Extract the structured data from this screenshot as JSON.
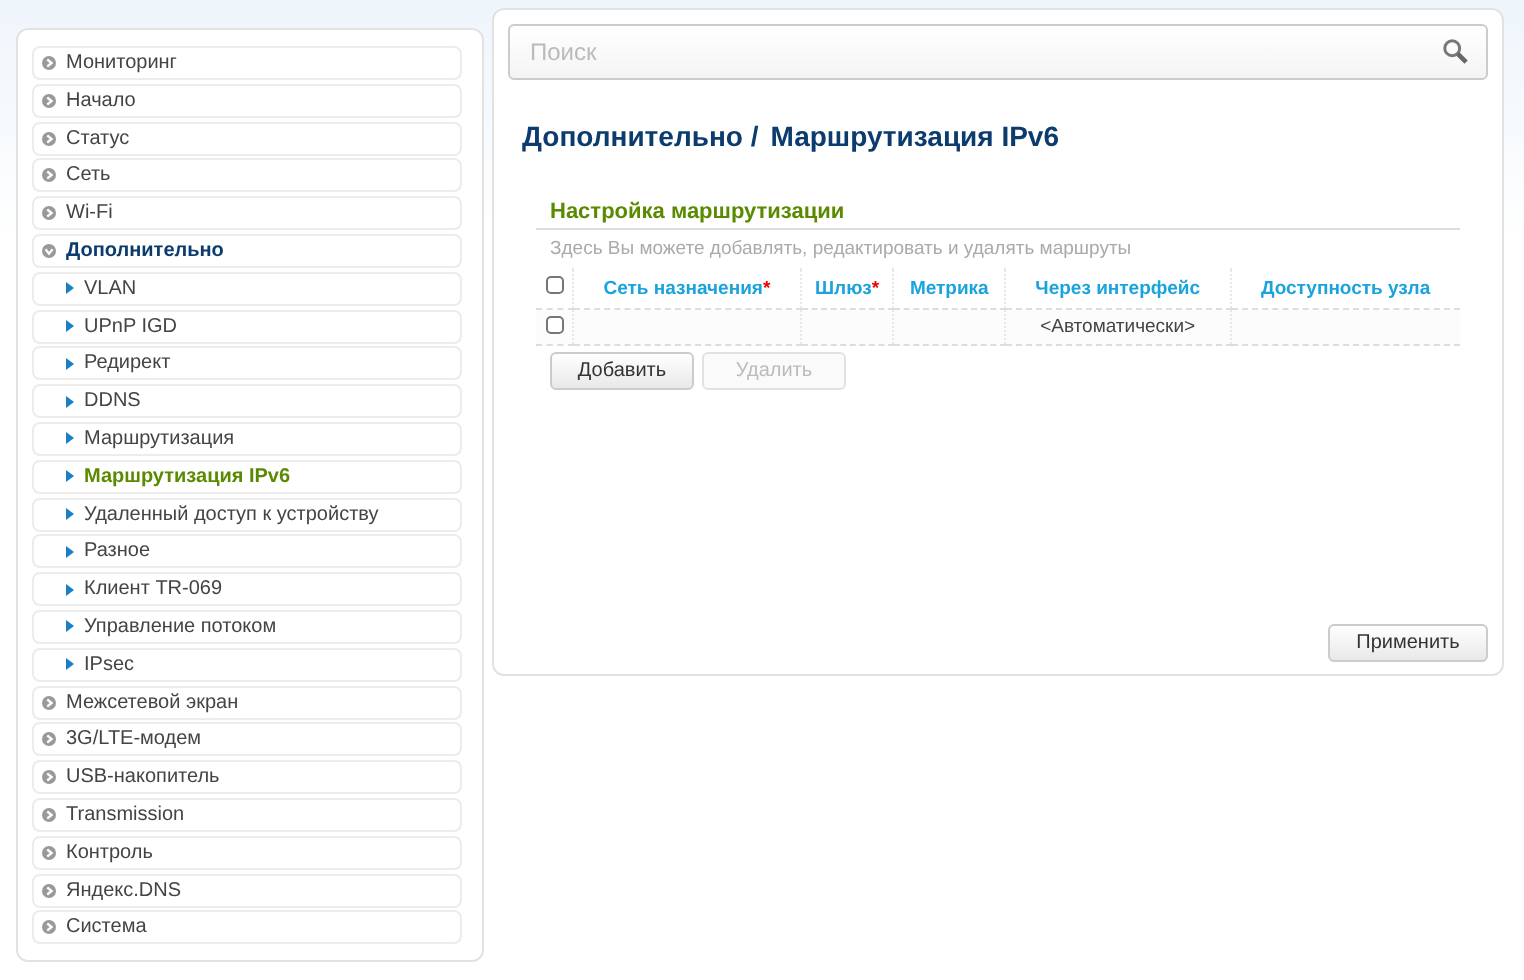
{
  "sidebar": {
    "items": [
      {
        "label": "Мониторинг",
        "expanded": false
      },
      {
        "label": "Начало",
        "expanded": false
      },
      {
        "label": "Статус",
        "expanded": false
      },
      {
        "label": "Сеть",
        "expanded": false
      },
      {
        "label": "Wi-Fi",
        "expanded": false
      },
      {
        "label": "Дополнительно",
        "expanded": true,
        "children": [
          {
            "label": "VLAN",
            "selected": false
          },
          {
            "label": "UPnP IGD",
            "selected": false
          },
          {
            "label": "Редирект",
            "selected": false
          },
          {
            "label": "DDNS",
            "selected": false
          },
          {
            "label": "Маршрутизация",
            "selected": false
          },
          {
            "label": "Маршрутизация IPv6",
            "selected": true
          },
          {
            "label": "Удаленный доступ к устройству",
            "selected": false
          },
          {
            "label": "Разное",
            "selected": false
          },
          {
            "label": "Клиент TR-069",
            "selected": false
          },
          {
            "label": "Управление потоком",
            "selected": false
          },
          {
            "label": "IPsec",
            "selected": false
          }
        ]
      },
      {
        "label": "Межсетевой экран",
        "expanded": false
      },
      {
        "label": "3G/LTE-модем",
        "expanded": false
      },
      {
        "label": "USB-накопитель",
        "expanded": false
      },
      {
        "label": "Transmission",
        "expanded": false
      },
      {
        "label": "Контроль",
        "expanded": false
      },
      {
        "label": "Яндекс.DNS",
        "expanded": false
      },
      {
        "label": "Система",
        "expanded": false
      }
    ]
  },
  "search": {
    "placeholder": "Поиск"
  },
  "breadcrumb": [
    "Дополнительно /",
    "Маршрутизация IPv6"
  ],
  "section": {
    "title": "Настройка маршрутизации",
    "description": "Здесь Вы можете добавлять, редактировать и удалять маршруты"
  },
  "table": {
    "select_all_checked": false,
    "columns": [
      {
        "label": "Сеть назначения",
        "marker": "*"
      },
      {
        "label": "Шлюз",
        "marker": "*"
      },
      {
        "label": "Метрика"
      },
      {
        "label": "Через интерфейс"
      },
      {
        "label": "Доступность узла"
      }
    ],
    "rows": [
      {
        "checked": false,
        "cells": [
          "",
          "",
          "",
          "<Автоматически>",
          ""
        ]
      }
    ]
  },
  "buttons": [
    {
      "label": "Добавить",
      "disabled": false
    },
    {
      "label": "Удалить",
      "disabled": true
    }
  ],
  "apply_button": {
    "label": "Применить",
    "disabled": false
  }
}
